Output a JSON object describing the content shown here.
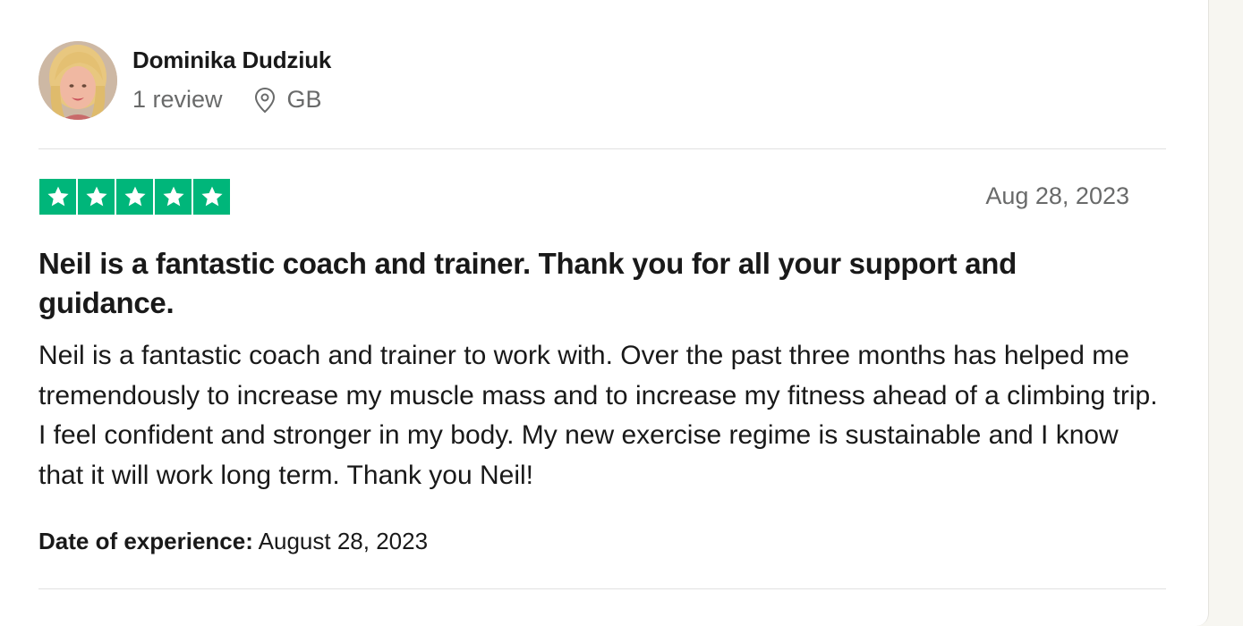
{
  "reviewer": {
    "name": "Dominika Dudziuk",
    "review_count": "1 review",
    "country": "GB",
    "location_icon": "map-pin-icon"
  },
  "review": {
    "rating": 5,
    "rating_max": 5,
    "star_color": "#00b67a",
    "date": "Aug 28, 2023",
    "title": "Neil is a fantastic coach and trainer. Thank you for all your support and guidance.",
    "body": "Neil is a fantastic coach and trainer to work with. Over the past three months has helped me tremendously to increase my muscle mass and to increase my fitness ahead of a climbing trip. I feel confident and stronger in my body. My new exercise regime is sustainable and I know that it will work long term. Thank you Neil!",
    "experience_label": "Date of experience:",
    "experience_date": "August 28, 2023"
  }
}
